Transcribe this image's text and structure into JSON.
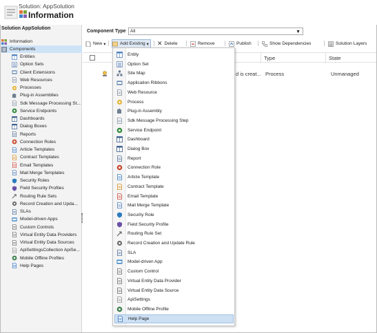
{
  "header": {
    "solution_label": "Solution: AppSolution",
    "title": "Information"
  },
  "sidebar": {
    "heading": "Solution AppSolution",
    "top_items": [
      {
        "label": "Information",
        "icon": "information-icon",
        "color": "#c8553d"
      },
      {
        "label": "Components",
        "icon": "components-icon",
        "color": "#6b7d96"
      }
    ],
    "items": [
      {
        "label": "Entities",
        "icon": "entity-icon"
      },
      {
        "label": "Option Sets",
        "icon": "option-set-icon"
      },
      {
        "label": "Client Extensions",
        "icon": "client-extension-icon"
      },
      {
        "label": "Web Resources",
        "icon": "web-resource-icon"
      },
      {
        "label": "Processes",
        "icon": "process-icon"
      },
      {
        "label": "Plug-in Assemblies",
        "icon": "plugin-assembly-icon"
      },
      {
        "label": "Sdk Message Processing St...",
        "icon": "sdk-message-icon"
      },
      {
        "label": "Service Endpoints",
        "icon": "service-endpoint-icon"
      },
      {
        "label": "Dashboards",
        "icon": "dashboard-icon"
      },
      {
        "label": "Dialog Boxes",
        "icon": "dialog-box-icon"
      },
      {
        "label": "Reports",
        "icon": "report-icon"
      },
      {
        "label": "Connection Roles",
        "icon": "connection-role-icon"
      },
      {
        "label": "Article Templates",
        "icon": "article-template-icon"
      },
      {
        "label": "Contract Templates",
        "icon": "contract-template-icon"
      },
      {
        "label": "Email Templates",
        "icon": "email-template-icon"
      },
      {
        "label": "Mail Merge Templates",
        "icon": "mail-merge-icon"
      },
      {
        "label": "Security Roles",
        "icon": "security-role-icon"
      },
      {
        "label": "Field Security Profiles",
        "icon": "field-security-icon"
      },
      {
        "label": "Routing Rule Sets",
        "icon": "routing-rule-icon"
      },
      {
        "label": "Record Creation and Upda...",
        "icon": "record-creation-icon"
      },
      {
        "label": "SLAs",
        "icon": "sla-icon"
      },
      {
        "label": "Model-driven Apps",
        "icon": "model-driven-app-icon"
      },
      {
        "label": "Custom Controls",
        "icon": "custom-control-icon"
      },
      {
        "label": "Virtual Entity Data Providers",
        "icon": "virtual-entity-provider-icon"
      },
      {
        "label": "Virtual Entity Data Sources",
        "icon": "virtual-entity-source-icon"
      },
      {
        "label": "ApiSettingsCollection ApiSe...",
        "icon": "api-settings-icon"
      },
      {
        "label": "Mobile Offline Profiles",
        "icon": "mobile-offline-icon"
      },
      {
        "label": "Help Pages",
        "icon": "help-page-icon"
      }
    ]
  },
  "main": {
    "component_type_label": "Component Type",
    "component_type_value": "All",
    "toolbar": {
      "new": "New",
      "add_existing": "Add Existing",
      "delete": "Delete",
      "remove": "Remove",
      "publish": "Publish",
      "show_dependencies": "Show Dependencies",
      "solution_layers": "Solution Layers"
    },
    "columns": {
      "type": "Type",
      "state": "State"
    },
    "row": {
      "description": "d is creat...",
      "type": "Process",
      "state": "Unmanaged"
    }
  },
  "menu": {
    "items": [
      {
        "label": "Entity",
        "icon": "entity-icon"
      },
      {
        "label": "Option Set",
        "icon": "option-set-icon"
      },
      {
        "label": "Site Map",
        "icon": "site-map-icon"
      },
      {
        "label": "Application Ribbons",
        "icon": "ribbon-icon"
      },
      {
        "label": "Web Resource",
        "icon": "web-resource-icon"
      },
      {
        "label": "Process",
        "icon": "process-icon"
      },
      {
        "label": "Plug-in Assembly",
        "icon": "plugin-assembly-icon"
      },
      {
        "label": "Sdk Message Processing Step",
        "icon": "sdk-message-icon"
      },
      {
        "label": "Service Endpoint",
        "icon": "service-endpoint-icon"
      },
      {
        "label": "Dashboard",
        "icon": "dashboard-icon"
      },
      {
        "label": "Dialog Box",
        "icon": "dialog-box-icon"
      },
      {
        "label": "Report",
        "icon": "report-icon"
      },
      {
        "label": "Connection Role",
        "icon": "connection-role-icon"
      },
      {
        "label": "Article Template",
        "icon": "article-template-icon"
      },
      {
        "label": "Contract Template",
        "icon": "contract-template-icon"
      },
      {
        "label": "Email Template",
        "icon": "email-template-icon"
      },
      {
        "label": "Mail Merge Template",
        "icon": "mail-merge-icon"
      },
      {
        "label": "Security Role",
        "icon": "security-role-icon"
      },
      {
        "label": "Field Security Profile",
        "icon": "field-security-icon"
      },
      {
        "label": "Routing Rule Set",
        "icon": "routing-rule-icon"
      },
      {
        "label": "Record Creation and Update Rule",
        "icon": "record-creation-icon"
      },
      {
        "label": "SLA",
        "icon": "sla-icon"
      },
      {
        "label": "Model-driven App",
        "icon": "model-driven-app-icon"
      },
      {
        "label": "Custom Control",
        "icon": "custom-control-icon"
      },
      {
        "label": "Virtual Entity Data Provider",
        "icon": "virtual-entity-provider-icon"
      },
      {
        "label": "Virtual Entity Data Source",
        "icon": "virtual-entity-source-icon"
      },
      {
        "label": "ApiSettings",
        "icon": "api-settings-icon"
      },
      {
        "label": "Mobile Offline Profile",
        "icon": "mobile-offline-icon"
      },
      {
        "label": "Help Page",
        "icon": "help-page-icon"
      }
    ],
    "highlighted": "Help Page"
  },
  "colors": {
    "selected_nav": "#cfe3f7",
    "menu_highlight": "#cde0f4",
    "sidebar_bg": "#f3f3f3"
  }
}
